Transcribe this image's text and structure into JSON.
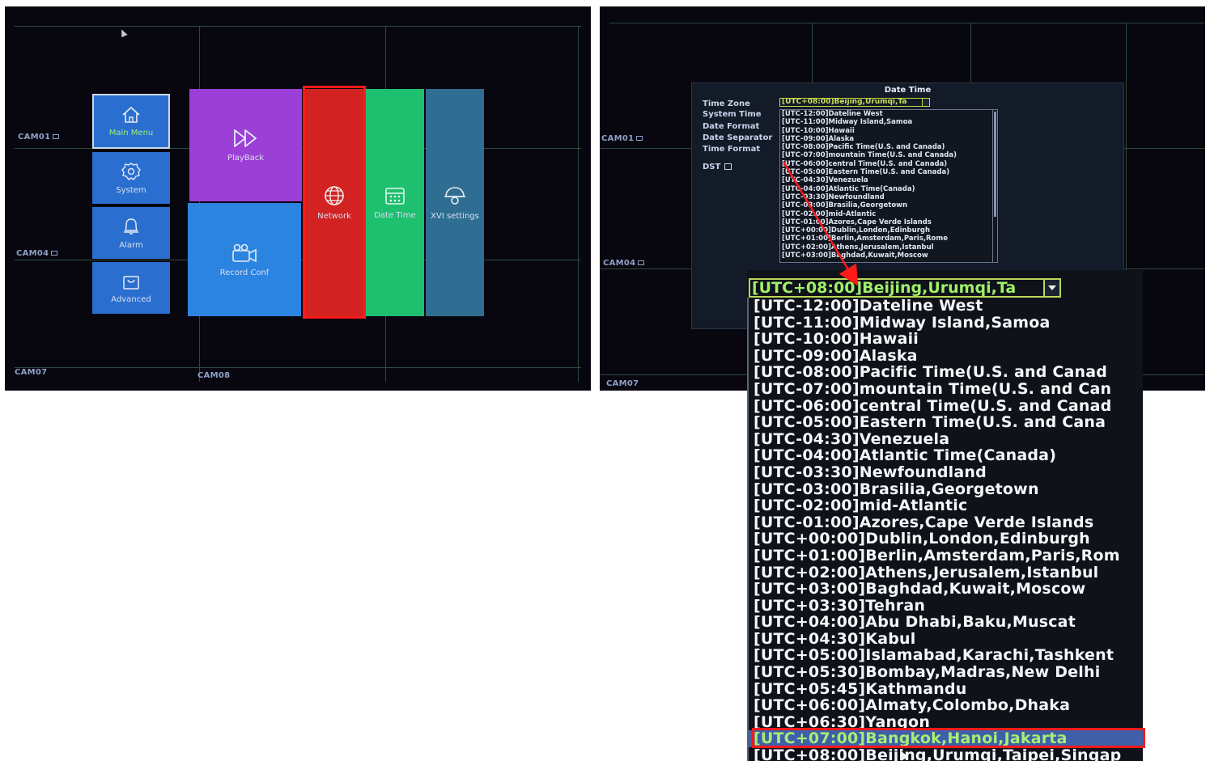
{
  "left_screen": {
    "cams": [
      "CAM01",
      "CAM04",
      "CAM07",
      "CAM08"
    ],
    "tiles": {
      "main_menu": "Main Menu",
      "system": "System",
      "alarm": "Alarm",
      "advanced": "Advanced",
      "playback": "PlayBack",
      "record_conf": "Record Conf",
      "network": "Network",
      "date_time": "Date Time",
      "xvi_settings": "XVI settings"
    },
    "highlight": "Network"
  },
  "right_screen": {
    "cams": [
      "CAM01",
      "CAM04",
      "CAM07"
    ],
    "dialog": {
      "title": "Date Time",
      "labels": {
        "time_zone": "Time Zone",
        "system_time": "System Time",
        "date_format": "Date Format",
        "date_separator": "Date Separator",
        "time_format": "Time Format",
        "dst": "DST"
      },
      "selected_zone": "[UTC+08:00]Beijing,Urumqi,Ta",
      "timezones": [
        "[UTC-12:00]Dateline West",
        "[UTC-11:00]Midway Island,Samoa",
        "[UTC-10:00]Hawaii",
        "[UTC-09:00]Alaska",
        "[UTC-08:00]Pacific Time(U.S. and Canada)",
        "[UTC-07:00]mountain Time(U.S. and Canada)",
        "[UTC-06:00]central Time(U.S. and Canada)",
        "[UTC-05:00]Eastern Time(U.S. and Canada)",
        "[UTC-04:30]Venezuela",
        "[UTC-04:00]Atlantic Time(Canada)",
        "[UTC-03:30]Newfoundland",
        "[UTC-03:00]Brasilia,Georgetown",
        "[UTC-02:00]mid-Atlantic",
        "[UTC-01:00]Azores,Cape Verde Islands",
        "[UTC+00:00]Dublin,London,Edinburgh",
        "[UTC+01:00]Berlin,Amsterdam,Paris,Rome",
        "[UTC+02:00]Athens,Jerusalem,Istanbul",
        "[UTC+03:00]Baghdad,Kuwait,Moscow"
      ]
    }
  },
  "zoom": {
    "selected_zone": "[UTC+08:00]Beijing,Urumqi,Ta",
    "timezones": [
      "[UTC-12:00]Dateline West",
      "[UTC-11:00]Midway Island,Samoa",
      "[UTC-10:00]Hawaii",
      "[UTC-09:00]Alaska",
      "[UTC-08:00]Pacific Time(U.S. and Canad",
      "[UTC-07:00]mountain Time(U.S. and Can",
      "[UTC-06:00]central Time(U.S. and Canad",
      "[UTC-05:00]Eastern Time(U.S. and Cana",
      "[UTC-04:30]Venezuela",
      "[UTC-04:00]Atlantic Time(Canada)",
      "[UTC-03:30]Newfoundland",
      "[UTC-03:00]Brasilia,Georgetown",
      "[UTC-02:00]mid-Atlantic",
      "[UTC-01:00]Azores,Cape Verde Islands",
      "[UTC+00:00]Dublin,London,Edinburgh",
      "[UTC+01:00]Berlin,Amsterdam,Paris,Rom",
      "[UTC+02:00]Athens,Jerusalem,Istanbul",
      "[UTC+03:00]Baghdad,Kuwait,Moscow",
      "[UTC+03:30]Tehran",
      "[UTC+04:00]Abu Dhabi,Baku,Muscat",
      "[UTC+04:30]Kabul",
      "[UTC+05:00]Islamabad,Karachi,Tashkent",
      "[UTC+05:30]Bombay,Madras,New Delhi",
      "[UTC+05:45]Kathmandu",
      "[UTC+06:00]Almaty,Colombo,Dhaka",
      "[UTC+06:30]Yangon",
      "[UTC+07:00]Bangkok,Hanoi,Jakarta",
      "[UTC+08:00]Beijing,Urumqi,Taipei,Singap"
    ],
    "selected_index": 26
  },
  "colors": {
    "highlight_red": "#ff1a1a",
    "selected_text": "#9ff06a",
    "selection_bg": "#3f5fa8"
  }
}
